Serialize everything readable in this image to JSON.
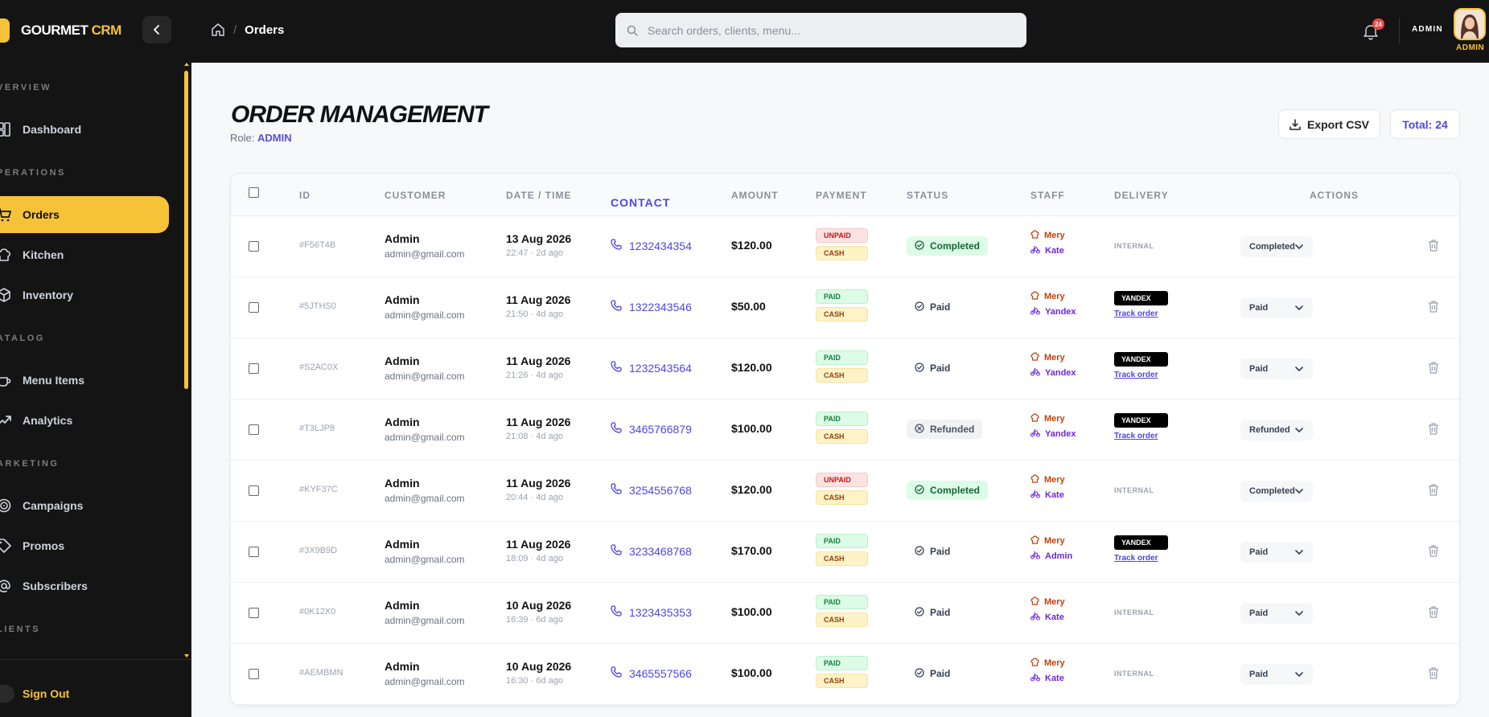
{
  "brand": {
    "name_main": "GOURMET",
    "name_accent": "CRM"
  },
  "sidebar": {
    "sections": [
      "VERVIEW",
      "PERATIONS",
      "ATALOG",
      "ARKETING",
      "LIENTS"
    ],
    "items": [
      {
        "label": "Dashboard",
        "icon": "dashboard-icon"
      },
      {
        "label": "Orders",
        "icon": "cart-icon"
      },
      {
        "label": "Kitchen",
        "icon": "chef-hat-icon"
      },
      {
        "label": "Inventory",
        "icon": "box-icon"
      },
      {
        "label": "Menu Items",
        "icon": "coffee-icon"
      },
      {
        "label": "Analytics",
        "icon": "trend-icon"
      },
      {
        "label": "Campaigns",
        "icon": "target-icon"
      },
      {
        "label": "Promos",
        "icon": "tag-icon"
      },
      {
        "label": "Subscribers",
        "icon": "at-icon"
      }
    ],
    "signout": "Sign Out"
  },
  "topbar": {
    "breadcrumb_current": "Orders",
    "search_placeholder": "Search orders, clients, menu...",
    "notifications_count": "24",
    "user_label": "ADMIN",
    "avatar_role": "ADMIN"
  },
  "page": {
    "title": "ORDER MANAGEMENT",
    "role_label": "Role:",
    "role_value": "ADMIN",
    "export_label": "Export CSV",
    "total_label": "Total: 24"
  },
  "table": {
    "headers": {
      "id": "ID",
      "customer": "CUSTOMER",
      "datetime": "DATE / TIME",
      "contact": "CONTACT",
      "amount": "AMOUNT",
      "payment": "PAYMENT",
      "status": "STATUS",
      "staff": "STAFF",
      "delivery": "DELIVERY",
      "actions": "ACTIONS"
    },
    "rows": [
      {
        "id": "#F56T4B",
        "name": "Admin",
        "email": "admin@gmail.com",
        "date": "13 Aug 2026",
        "time": "22:47 · 2d ago",
        "phone": "1232434354",
        "amount": "$120.00",
        "pay": "UNPAID",
        "method": "CASH",
        "status": "Completed",
        "cook": "Mery",
        "courier": "Kate",
        "delivery": "INTERNAL",
        "track": "",
        "action": "Completed"
      },
      {
        "id": "#5JTHS0",
        "name": "Admin",
        "email": "admin@gmail.com",
        "date": "11 Aug 2026",
        "time": "21:50 · 4d ago",
        "phone": "1322343546",
        "amount": "$50.00",
        "pay": "PAID",
        "method": "CASH",
        "status": "Paid",
        "cook": "Mery",
        "courier": "Yandex",
        "delivery": "YANDEX",
        "track": "Track order",
        "action": "Paid"
      },
      {
        "id": "#S2AC0X",
        "name": "Admin",
        "email": "admin@gmail.com",
        "date": "11 Aug 2026",
        "time": "21:26 · 4d ago",
        "phone": "1232543564",
        "amount": "$120.00",
        "pay": "PAID",
        "method": "CASH",
        "status": "Paid",
        "cook": "Mery",
        "courier": "Yandex",
        "delivery": "YANDEX",
        "track": "Track order",
        "action": "Paid"
      },
      {
        "id": "#T3LJP8",
        "name": "Admin",
        "email": "admin@gmail.com",
        "date": "11 Aug 2026",
        "time": "21:08 · 4d ago",
        "phone": "3465766879",
        "amount": "$100.00",
        "pay": "PAID",
        "method": "CASH",
        "status": "Refunded",
        "cook": "Mery",
        "courier": "Yandex",
        "delivery": "YANDEX",
        "track": "Track order",
        "action": "Refunded"
      },
      {
        "id": "#KYF37C",
        "name": "Admin",
        "email": "admin@gmail.com",
        "date": "11 Aug 2026",
        "time": "20:44 · 4d ago",
        "phone": "3254556768",
        "amount": "$120.00",
        "pay": "UNPAID",
        "method": "CASH",
        "status": "Completed",
        "cook": "Mery",
        "courier": "Kate",
        "delivery": "INTERNAL",
        "track": "",
        "action": "Completed"
      },
      {
        "id": "#3X9B9D",
        "name": "Admin",
        "email": "admin@gmail.com",
        "date": "11 Aug 2026",
        "time": "18:09 · 4d ago",
        "phone": "3233468768",
        "amount": "$170.00",
        "pay": "PAID",
        "method": "CASH",
        "status": "Paid",
        "cook": "Mery",
        "courier": "Admin",
        "delivery": "YANDEX",
        "track": "Track order",
        "action": "Paid"
      },
      {
        "id": "#0K12X0",
        "name": "Admin",
        "email": "admin@gmail.com",
        "date": "10 Aug 2026",
        "time": "16:39 · 6d ago",
        "phone": "1323435353",
        "amount": "$100.00",
        "pay": "PAID",
        "method": "CASH",
        "status": "Paid",
        "cook": "Mery",
        "courier": "Kate",
        "delivery": "INTERNAL",
        "track": "",
        "action": "Paid"
      },
      {
        "id": "#AEMBMN",
        "name": "Admin",
        "email": "admin@gmail.com",
        "date": "10 Aug 2026",
        "time": "16:30 · 6d ago",
        "phone": "3465557566",
        "amount": "$100.00",
        "pay": "PAID",
        "method": "CASH",
        "status": "Paid",
        "cook": "Mery",
        "courier": "Kate",
        "delivery": "INTERNAL",
        "track": "",
        "action": "Paid"
      }
    ]
  },
  "colors": {
    "accent": "#f6c238",
    "brand_indigo": "#4f46e5",
    "sidebar_bg": "#141414"
  }
}
